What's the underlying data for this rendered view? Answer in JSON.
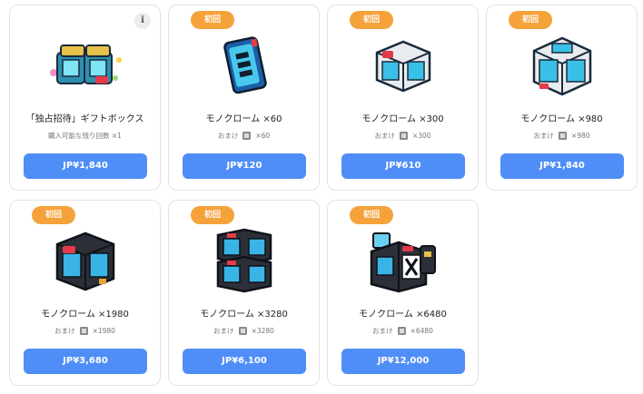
{
  "colors": {
    "tag": "#f5a23a",
    "button": "#4f8ef7",
    "border": "#e3e3e3"
  },
  "products": [
    {
      "name": "「独占招待」ギフトボックス",
      "sub_text": "購入可能な残り回数 ×1",
      "price": "JP¥1,840",
      "icon": "gift-box-icon",
      "info": "i"
    },
    {
      "tag": "初回",
      "name": "モノクローム ×60",
      "bonus_label": "おまけ",
      "bonus_count": "×60",
      "price": "JP¥120",
      "icon": "monochrome-60-icon"
    },
    {
      "tag": "初回",
      "name": "モノクローム ×300",
      "bonus_label": "おまけ",
      "bonus_count": "×300",
      "price": "JP¥610",
      "icon": "monochrome-300-icon"
    },
    {
      "tag": "初回",
      "name": "モノクローム ×980",
      "bonus_label": "おまけ",
      "bonus_count": "×980",
      "price": "JP¥1,840",
      "icon": "monochrome-980-icon"
    },
    {
      "tag": "初回",
      "name": "モノクローム ×1980",
      "bonus_label": "おまけ",
      "bonus_count": "×1980",
      "price": "JP¥3,680",
      "icon": "monochrome-1980-icon"
    },
    {
      "tag": "初回",
      "name": "モノクローム ×3280",
      "bonus_label": "おまけ",
      "bonus_count": "×3280",
      "price": "JP¥6,100",
      "icon": "monochrome-3280-icon"
    },
    {
      "tag": "初回",
      "name": "モノクローム ×6480",
      "bonus_label": "おまけ",
      "bonus_count": "×6480",
      "price": "JP¥12,000",
      "icon": "monochrome-6480-icon"
    }
  ]
}
